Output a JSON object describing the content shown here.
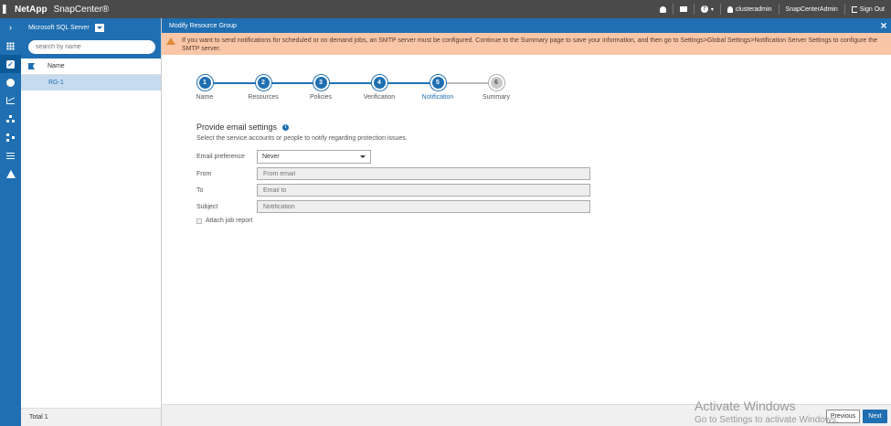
{
  "topbar": {
    "brand": "NetApp",
    "product": "SnapCenter®",
    "help_label": "?",
    "user": "clusteradmin",
    "role": "SnapCenterAdmin",
    "signout": "Sign Out"
  },
  "left_panel": {
    "plugin": "Microsoft SQL Server",
    "search_placeholder": "search by name",
    "column_name": "Name",
    "rows": [
      "RG-1"
    ],
    "total": "Total 1"
  },
  "main": {
    "title": "Modify Resource Group",
    "close": "×",
    "alert": "If you want to send notifications for scheduled or on demand jobs, an SMTP server must be configured. Continue to the Summary page to save your information, and then go to Settings>Global Settings>Notification Server Settings to configure the SMTP server."
  },
  "steps": [
    {
      "num": "1",
      "label": "Name"
    },
    {
      "num": "2",
      "label": "Resources"
    },
    {
      "num": "3",
      "label": "Policies"
    },
    {
      "num": "4",
      "label": "Verification"
    },
    {
      "num": "5",
      "label": "Notification"
    },
    {
      "num": "6",
      "label": "Summary"
    }
  ],
  "form": {
    "heading": "Provide email settings",
    "info": "i",
    "subtitle": "Select the service accounts or people to notify regarding protection issues.",
    "email_pref_label": "Email preference",
    "email_pref_value": "Never",
    "from_label": "From",
    "from_placeholder": "From email",
    "to_label": "To",
    "to_placeholder": "Email to",
    "subject_label": "Subject",
    "subject_placeholder": "Notification",
    "attach_label": "Attach job report"
  },
  "footer": {
    "previous": "Previous",
    "next": "Next"
  },
  "watermark": {
    "line1": "Activate Windows",
    "line2": "Go to Settings to activate Windows."
  },
  "colors": {
    "accent": "#1f6fb2",
    "topbar": "#4a4a4a",
    "alert_bg": "#f9c7a8",
    "selected_row": "#c7dbf0"
  }
}
